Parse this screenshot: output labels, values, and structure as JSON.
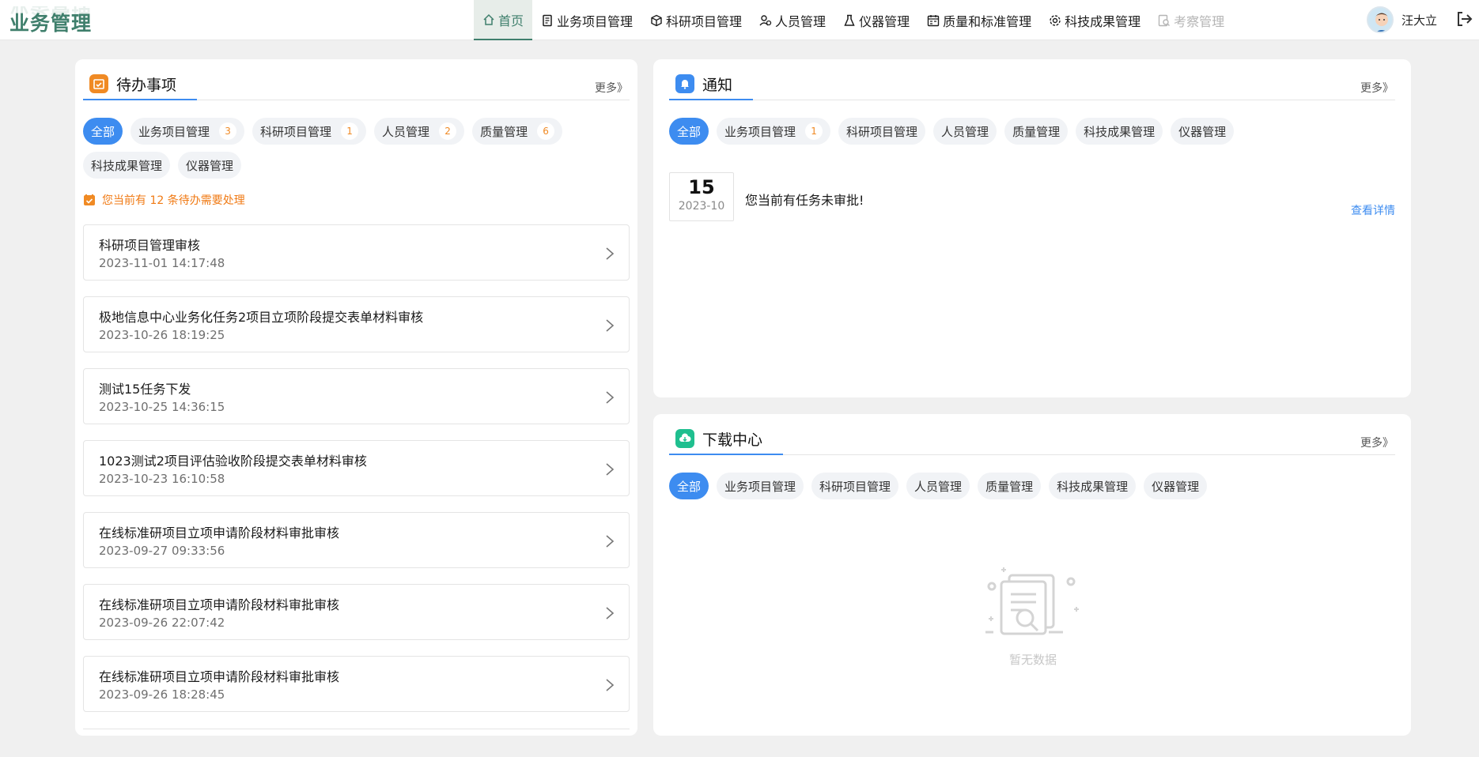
{
  "app": {
    "title": "业务管理"
  },
  "nav": [
    {
      "label": "首页",
      "active": true,
      "disabled": false,
      "icon": "home-icon"
    },
    {
      "label": "业务项目管理",
      "active": false,
      "disabled": false,
      "icon": "document-icon"
    },
    {
      "label": "科研项目管理",
      "active": false,
      "disabled": false,
      "icon": "cube-icon"
    },
    {
      "label": "人员管理",
      "active": false,
      "disabled": false,
      "icon": "people-icon"
    },
    {
      "label": "仪器管理",
      "active": false,
      "disabled": false,
      "icon": "flask-icon"
    },
    {
      "label": "质量和标准管理",
      "active": false,
      "disabled": false,
      "icon": "calendar-icon"
    },
    {
      "label": "科技成果管理",
      "active": false,
      "disabled": false,
      "icon": "gear-icon"
    },
    {
      "label": "考察管理",
      "active": false,
      "disabled": true,
      "icon": "search-doc-icon"
    }
  ],
  "user": {
    "name": "汪大立"
  },
  "todo": {
    "title": "待办事项",
    "more": "更多》",
    "tabs": [
      {
        "label": "全部",
        "count": "",
        "active": true
      },
      {
        "label": "业务项目管理",
        "count": "3",
        "active": false
      },
      {
        "label": "科研项目管理",
        "count": "1",
        "active": false
      },
      {
        "label": "人员管理",
        "count": "2",
        "active": false
      },
      {
        "label": "质量管理",
        "count": "6",
        "active": false
      },
      {
        "label": "科技成果管理",
        "count": "",
        "active": false
      },
      {
        "label": "仪器管理",
        "count": "",
        "active": false
      }
    ],
    "hint": "您当前有 12 条待办需要处理",
    "items": [
      {
        "title": "科研项目管理审核",
        "time": "2023-11-01 14:17:48"
      },
      {
        "title": "极地信息中心业务化任务2项目立项阶段提交表单材料审核",
        "time": "2023-10-26 18:19:25"
      },
      {
        "title": "测试15任务下发",
        "time": "2023-10-25 14:36:15"
      },
      {
        "title": "1023测试2项目评估验收阶段提交表单材料审核",
        "time": "2023-10-23 16:10:58"
      },
      {
        "title": "在线标准研项目立项申请阶段材料审批审核",
        "time": "2023-09-27 09:33:56"
      },
      {
        "title": "在线标准研项目立项申请阶段材料审批审核",
        "time": "2023-09-26 22:07:42"
      },
      {
        "title": "在线标准研项目立项申请阶段材料审批审核",
        "time": "2023-09-26 18:28:45"
      }
    ]
  },
  "notice": {
    "title": "通知",
    "more": "更多》",
    "tabs": [
      {
        "label": "全部",
        "count": "",
        "active": true
      },
      {
        "label": "业务项目管理",
        "count": "1",
        "active": false
      },
      {
        "label": "科研项目管理",
        "count": "",
        "active": false
      },
      {
        "label": "人员管理",
        "count": "",
        "active": false
      },
      {
        "label": "质量管理",
        "count": "",
        "active": false
      },
      {
        "label": "科技成果管理",
        "count": "",
        "active": false
      },
      {
        "label": "仪器管理",
        "count": "",
        "active": false
      }
    ],
    "items": [
      {
        "day": "15",
        "month": "2023-10",
        "text": "您当前有任务未审批!",
        "link": "查看详情"
      }
    ]
  },
  "download": {
    "title": "下载中心",
    "more": "更多》",
    "tabs": [
      {
        "label": "全部",
        "active": true
      },
      {
        "label": "业务项目管理",
        "active": false
      },
      {
        "label": "科研项目管理",
        "active": false
      },
      {
        "label": "人员管理",
        "active": false
      },
      {
        "label": "质量管理",
        "active": false
      },
      {
        "label": "科技成果管理",
        "active": false
      },
      {
        "label": "仪器管理",
        "active": false
      }
    ],
    "empty_text": "暂无数据"
  },
  "colors": {
    "brand": "#3f7f6c",
    "primary": "#3d8cf0",
    "todo_icon": "#f08a24",
    "notice_icon": "#3d8cf0",
    "download_icon": "#1fbf8f",
    "hint": "#f07a14"
  }
}
